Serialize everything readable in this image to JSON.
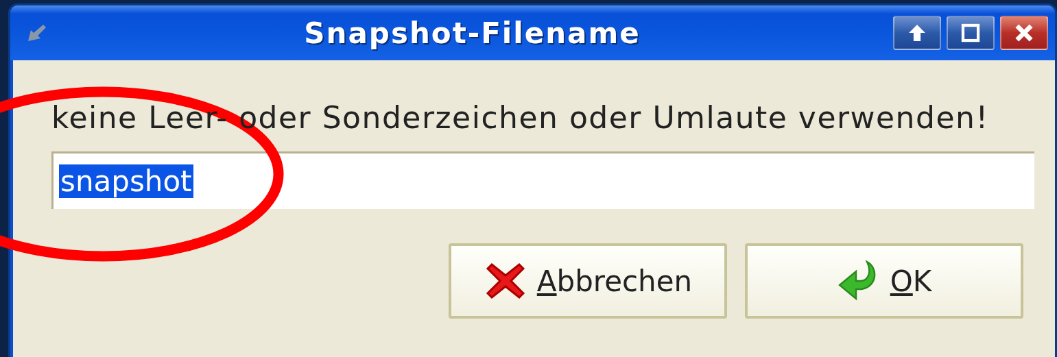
{
  "window": {
    "title": "Snapshot-Filename"
  },
  "prompt": "keine Leer- oder Sonderzeichen oder Umlaute verwenden!",
  "filename_field": {
    "value": "snapshot",
    "selected": true
  },
  "buttons": [
    {
      "label": "Abbrechen",
      "kind": "cancel"
    },
    {
      "label": "OK",
      "kind": "ok"
    }
  ]
}
